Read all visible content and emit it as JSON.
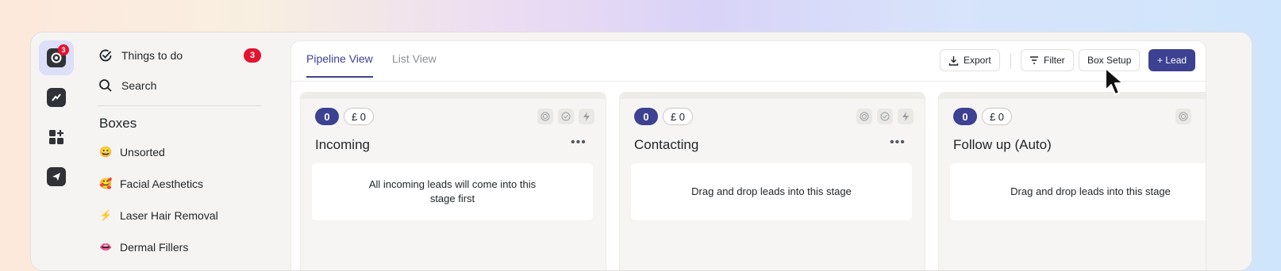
{
  "rail": {
    "logo_badge": "3",
    "items": [
      {
        "icon": "logo-icon"
      },
      {
        "icon": "trending-chart-icon"
      },
      {
        "icon": "apps-grid-icon"
      },
      {
        "icon": "send-icon"
      }
    ]
  },
  "sidebar": {
    "things_to_do": {
      "label": "Things to do",
      "count": "3",
      "icon": "check-circle-icon"
    },
    "search": {
      "label": "Search",
      "icon": "search-icon"
    },
    "boxes_title": "Boxes",
    "boxes": [
      {
        "emoji": "😀",
        "label": "Unsorted"
      },
      {
        "emoji": "🥰",
        "label": "Facial Aesthetics"
      },
      {
        "emoji": "⚡",
        "label": "Laser Hair Removal"
      },
      {
        "emoji": "👄",
        "label": "Dermal Fillers"
      }
    ]
  },
  "topbar": {
    "tabs": [
      {
        "label": "Pipeline View",
        "active": true
      },
      {
        "label": "List View",
        "active": false
      }
    ],
    "export_label": "Export",
    "filter_label": "Filter",
    "box_setup_label": "Box Setup",
    "lead_label": "+ Lead"
  },
  "columns": [
    {
      "count": "0",
      "value": "£ 0",
      "title": "Incoming",
      "placeholder": "All incoming leads will come into this stage first"
    },
    {
      "count": "0",
      "value": "£ 0",
      "title": "Contacting",
      "placeholder": "Drag and drop leads into this stage"
    },
    {
      "count": "0",
      "value": "£ 0",
      "title": "Follow up (Auto)",
      "placeholder": "Drag and drop leads into this stage"
    }
  ],
  "colors": {
    "accent": "#3c4191",
    "badge_red": "#e3132f"
  }
}
